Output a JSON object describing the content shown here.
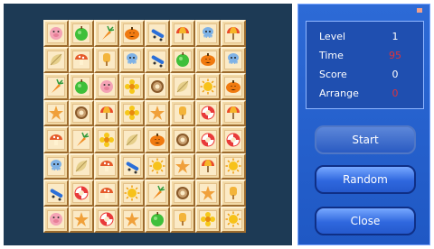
{
  "stats": {
    "level_label": "Level",
    "level_value": "1",
    "time_label": "Time",
    "time_value": "95",
    "score_label": "Score",
    "score_value": "0",
    "arrange_label": "Arrange",
    "arrange_value": "0"
  },
  "buttons": {
    "start": "Start",
    "random": "Random",
    "close": "Close"
  },
  "colors": {
    "board_bg": "#1d3a55",
    "panel_bg": "#2d6ad6",
    "value_red": "#e0323a"
  },
  "board": [
    [
      "pig-icon",
      "apple-icon",
      "carrot-icon",
      "pumpkin-icon",
      "skateboard-icon",
      "umbrella-icon",
      "octopus-icon",
      "umbrella-icon"
    ],
    [
      "leaf-icon",
      "mushroom-icon",
      "popsicle-icon",
      "octopus-icon",
      "skateboard-icon",
      "apple-icon",
      "pumpkin-icon",
      "octopus-icon"
    ],
    [
      "carrot-icon",
      "apple-icon",
      "pig-icon",
      "flower-icon",
      "donut-icon",
      "leaf-icon",
      "sun-icon",
      "pumpkin-icon"
    ],
    [
      "starfish-icon",
      "donut-icon",
      "umbrella-icon",
      "flower-icon",
      "starfish-icon",
      "popsicle-icon",
      "lifebuoy-icon",
      "umbrella-icon"
    ],
    [
      "mushroom-icon",
      "carrot-icon",
      "flower-icon",
      "leaf-icon",
      "pumpkin-icon",
      "donut-icon",
      "lifebuoy-icon",
      "lifebuoy-icon"
    ],
    [
      "octopus-icon",
      "leaf-icon",
      "mushroom-icon",
      "skateboard-icon",
      "sun-icon",
      "starfish-icon",
      "umbrella-icon",
      "sun-icon"
    ],
    [
      "skateboard-icon",
      "lifebuoy-icon",
      "mushroom-icon",
      "sun-icon",
      "carrot-icon",
      "donut-icon",
      "starfish-icon",
      "popsicle-icon"
    ],
    [
      "pig-icon",
      "starfish-icon",
      "lifebuoy-icon",
      "starfish-icon",
      "apple-icon",
      "popsicle-icon",
      "flower-icon",
      "sun-icon"
    ]
  ]
}
